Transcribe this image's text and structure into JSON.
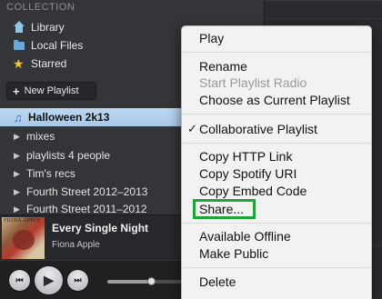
{
  "sidebar": {
    "section_header": "COLLECTION",
    "collection_items": [
      {
        "label": "Library",
        "icon": "home-icon"
      },
      {
        "label": "Local Files",
        "icon": "folder-icon"
      },
      {
        "label": "Starred",
        "icon": "star-icon"
      }
    ],
    "star_glyph": "★",
    "new_playlist_label": "New Playlist",
    "plus_glyph": "+",
    "playlists": [
      {
        "label": "Halloween 2k13",
        "selected": true
      },
      {
        "label": "mixes"
      },
      {
        "label": "playlists 4 people"
      },
      {
        "label": "Tim's recs"
      },
      {
        "label": "Fourth Street 2012–2013"
      },
      {
        "label": "Fourth Street 2011–2012"
      }
    ],
    "note_glyph": "♫",
    "triangle_glyph": "▶"
  },
  "now_playing": {
    "title": "Every Single Night",
    "artist": "Fiona Apple",
    "album_art_text": "FIONA APPLE"
  },
  "controls": {
    "prev_glyph": "⏮",
    "play_glyph": "▶",
    "next_glyph": "⏭",
    "seek_progress": 0.28
  },
  "context_menu": {
    "groups": [
      [
        {
          "label": "Play"
        }
      ],
      [
        {
          "label": "Rename"
        },
        {
          "label": "Start Playlist Radio",
          "disabled": true
        },
        {
          "label": "Choose as Current Playlist"
        }
      ],
      [
        {
          "label": "Collaborative Playlist",
          "checked": true
        }
      ],
      [
        {
          "label": "Copy HTTP Link"
        },
        {
          "label": "Copy Spotify URI"
        },
        {
          "label": "Copy Embed Code"
        },
        {
          "label": "Share..."
        }
      ],
      [
        {
          "label": "Available Offline"
        },
        {
          "label": "Make Public"
        }
      ],
      [
        {
          "label": "Delete"
        }
      ]
    ],
    "check_glyph": "✓",
    "highlight_color": "#1fa53a"
  }
}
